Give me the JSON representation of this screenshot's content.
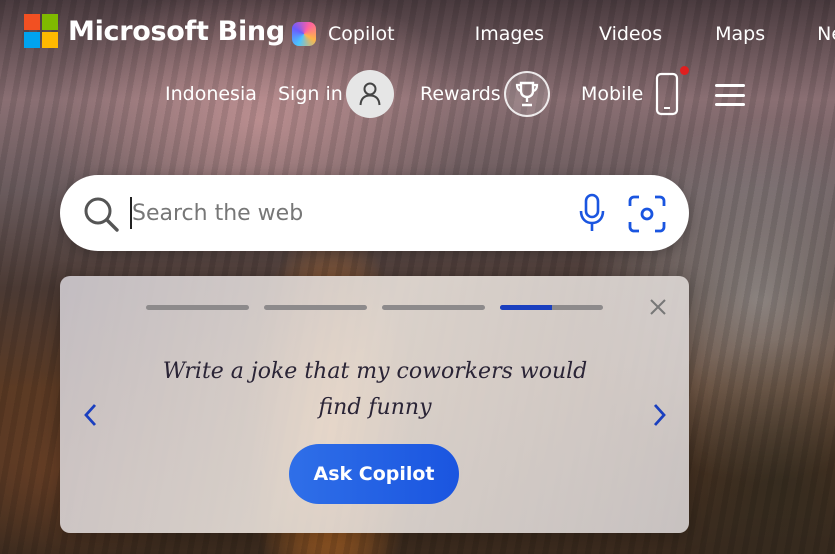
{
  "brand": {
    "name": "Microsoft Bing",
    "logo_colors": [
      "#f25022",
      "#7fba00",
      "#00a4ef",
      "#ffb900"
    ]
  },
  "nav": {
    "copilot": "Copilot",
    "images": "Images",
    "videos": "Videos",
    "maps": "Maps",
    "news": "News"
  },
  "account": {
    "region": "Indonesia",
    "sign_in": "Sign in",
    "rewards": "Rewards",
    "mobile": "Mobile"
  },
  "search": {
    "placeholder": "Search the web",
    "icon": "search-icon",
    "mic_icon": "microphone-icon",
    "visual_icon": "visual-search-icon",
    "accent_color": "#1a55e0"
  },
  "prompt_card": {
    "text": "Write a joke that my coworkers would find funny",
    "button_label": "Ask Copilot",
    "progress": [
      1,
      1,
      1,
      0.5
    ]
  }
}
